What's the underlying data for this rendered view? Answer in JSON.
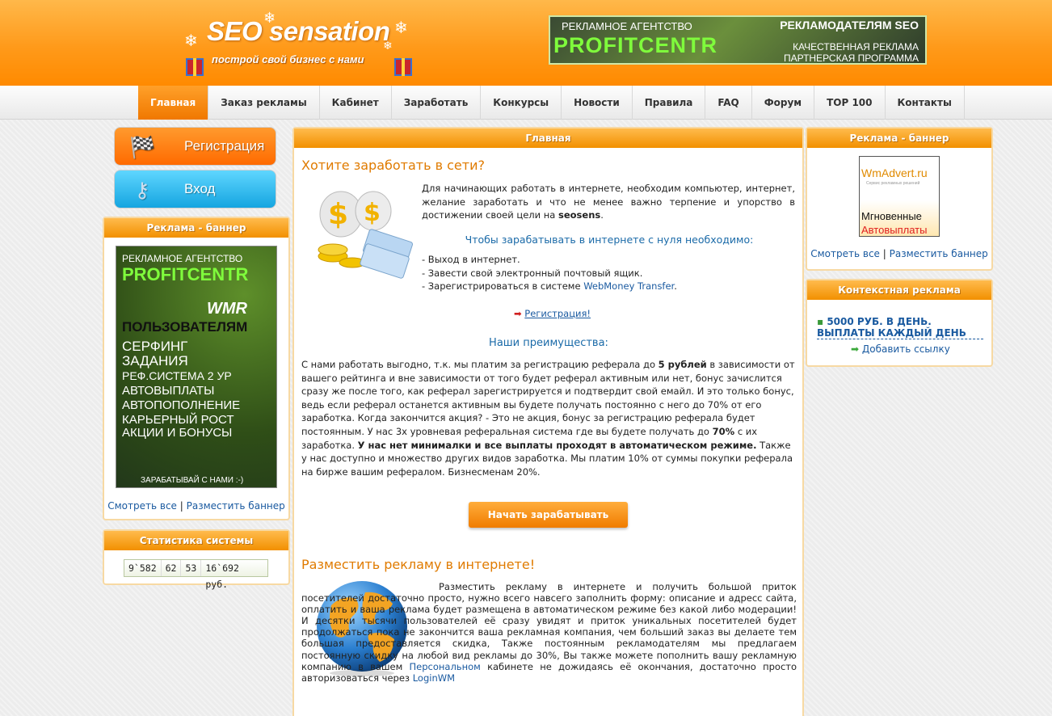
{
  "header": {
    "logo_title": "SEO sensation",
    "logo_slogan": "построй свой бизнес с нами",
    "top_banner": {
      "line1": "РЕКЛАМНОЕ АГЕНТСТВО",
      "line2": "PROFITCENTR",
      "right1": "РЕКЛАМОДАТЕЛЯМ SEO",
      "right2": "КАЧЕСТВЕННАЯ РЕКЛАМА",
      "right3": "ПАРТНЕРСКАЯ ПРОГРАММА"
    }
  },
  "nav": {
    "items": [
      "Главная",
      "Заказ рекламы",
      "Кабинет",
      "Заработать",
      "Конкурсы",
      "Новости",
      "Правила",
      "FAQ",
      "Форум",
      "TOP 100",
      "Контакты"
    ],
    "active": "Главная"
  },
  "left": {
    "register_label": "Регистрация",
    "login_label": "Вход",
    "ad_box_title": "Реклама - баннер",
    "banner": {
      "lines": [
        "РЕКЛАМНОЕ АГЕНТСТВО",
        "PROFITCENTR",
        "WMR",
        "ПОЛЬЗОВАТЕЛЯМ",
        "СЕРФИНГ",
        "ЗАДАНИЯ",
        "РЕФ.СИСТЕМА 2 УР",
        "АВТОВЫПЛАТЫ",
        "АВТОПОПОЛНЕНИЕ",
        "КАРЬЕРНЫЙ РОСТ",
        "АКЦИИ И БОНУСЫ",
        "ЗАРАБАТЫВАЙ С НАМИ :-)"
      ]
    },
    "view_all": "Смотреть все",
    "separator": "|",
    "place_banner": "Разместить баннер",
    "stats_title": "Статистика системы",
    "stats": [
      "9`582",
      "62",
      "53",
      "16`692 руб."
    ]
  },
  "main": {
    "box_title": "Главная",
    "earn_title": "Хотите заработать в сети?",
    "intro_text": "Для начинающих работать в интернете, необходим компьютер, интернет, желание заработать и что не менее важно терпение и упорство в достижении своей цели на",
    "intro_brand": "seosens",
    "intro_end": ".",
    "need_title": "Чтобы зарабатывать в интернете с нуля необходимо:",
    "need_items": [
      "- Выход в интернет.",
      "- Завести свой электронный почтовый ящик."
    ],
    "need_item3_text": "- Зарегистрироваться в системе",
    "need_item3_link": "WebMoney Transfer",
    "need_item3_end": ".",
    "register_link": "Регистрация!",
    "advantages_title": "Наши преимущества:",
    "adv_text_1": "С нами работать выгодно, т.к. мы платим за регистрацию реферала до",
    "adv_bold_1": "5 рублей",
    "adv_text_2": "в зависимости от вашего рейтинга и вне зависимости от того будет реферал активным или нет, бонус зачислится сразу же после того, как реферал зарегистрируется и подтвердит свой емайл. И это только бонус, ведь если реферал останется активным вы будете получать постоянно с него до 70% от его заработка. Когда закончится акция? - Это не акция, бонус за регистрацию реферала будет постоянным. У нас 3х уровневая реферальная система где вы будете получать до",
    "adv_bold_2": "70%",
    "adv_text_3": "с их заработка.",
    "adv_bold_3": "У нас нет минималки и все выплаты проходят в автоматическом режиме.",
    "adv_text_4": "Также у нас доступно и множество других видов заработка. Мы платим 10% от суммы покупки реферала на бирже вашим рефералом. Бизнесменам 20%.",
    "start_button": "Начать зарабатывать",
    "ad_title": "Разместить рекламу в интернете!",
    "ad_text_1": "Разместить рекламу в интернете и получить большой приток посетителей достаточно просто, нужно всего навсего заполнить форму: описание и адресс сайта, оплатить и ваша реклама будет размещена в автоматическом режиме без какой либо модерации! И десятки тысячи пользователей её сразу увидят и приток уникальных посетителей будет продолжаться пока не закончится ваша рекламная компания, чем больший заказ вы делаете тем большая предоставляется скидка, Также постоянным рекламодателям мы предлагаем постоянную скидку на любой вид рекламы до 30%, Вы также можете пополнить вашу рекламную компанию в вашем",
    "ad_link_1": "Персональном",
    "ad_text_2": "кабинете не дожидаясь её окончания, достаточно просто авторизоваться через",
    "ad_link_2": "LoginWM"
  },
  "right": {
    "ad_box_title": "Реклама - баннер",
    "wm_banner": {
      "brand": "WmAdvert.ru",
      "tagline": "Сервис рекламных решений",
      "line1": "Мгновенные",
      "line2": "Автовыплаты"
    },
    "view_all": "Смотреть все",
    "separator": "|",
    "place_banner": "Разместить баннер",
    "context_title": "Контекстная реклама",
    "context_ad_line1": "5000 РУБ. В ДЕНЬ.",
    "context_ad_line2": "ВЫПЛАТЫ КАЖДЫЙ ДЕНЬ",
    "add_link": "Добавить ссылку"
  },
  "colors": {
    "accent_orange": "#f29000",
    "link_blue": "#1a5aa0",
    "title_orange": "#e07b00"
  },
  "icons": [
    "snowflake-icon",
    "gift-icon",
    "checkered-flag-icon",
    "key-icon",
    "money-bags-icon",
    "arrow-right-icon",
    "globe-icon",
    "green-arrow-icon"
  ]
}
